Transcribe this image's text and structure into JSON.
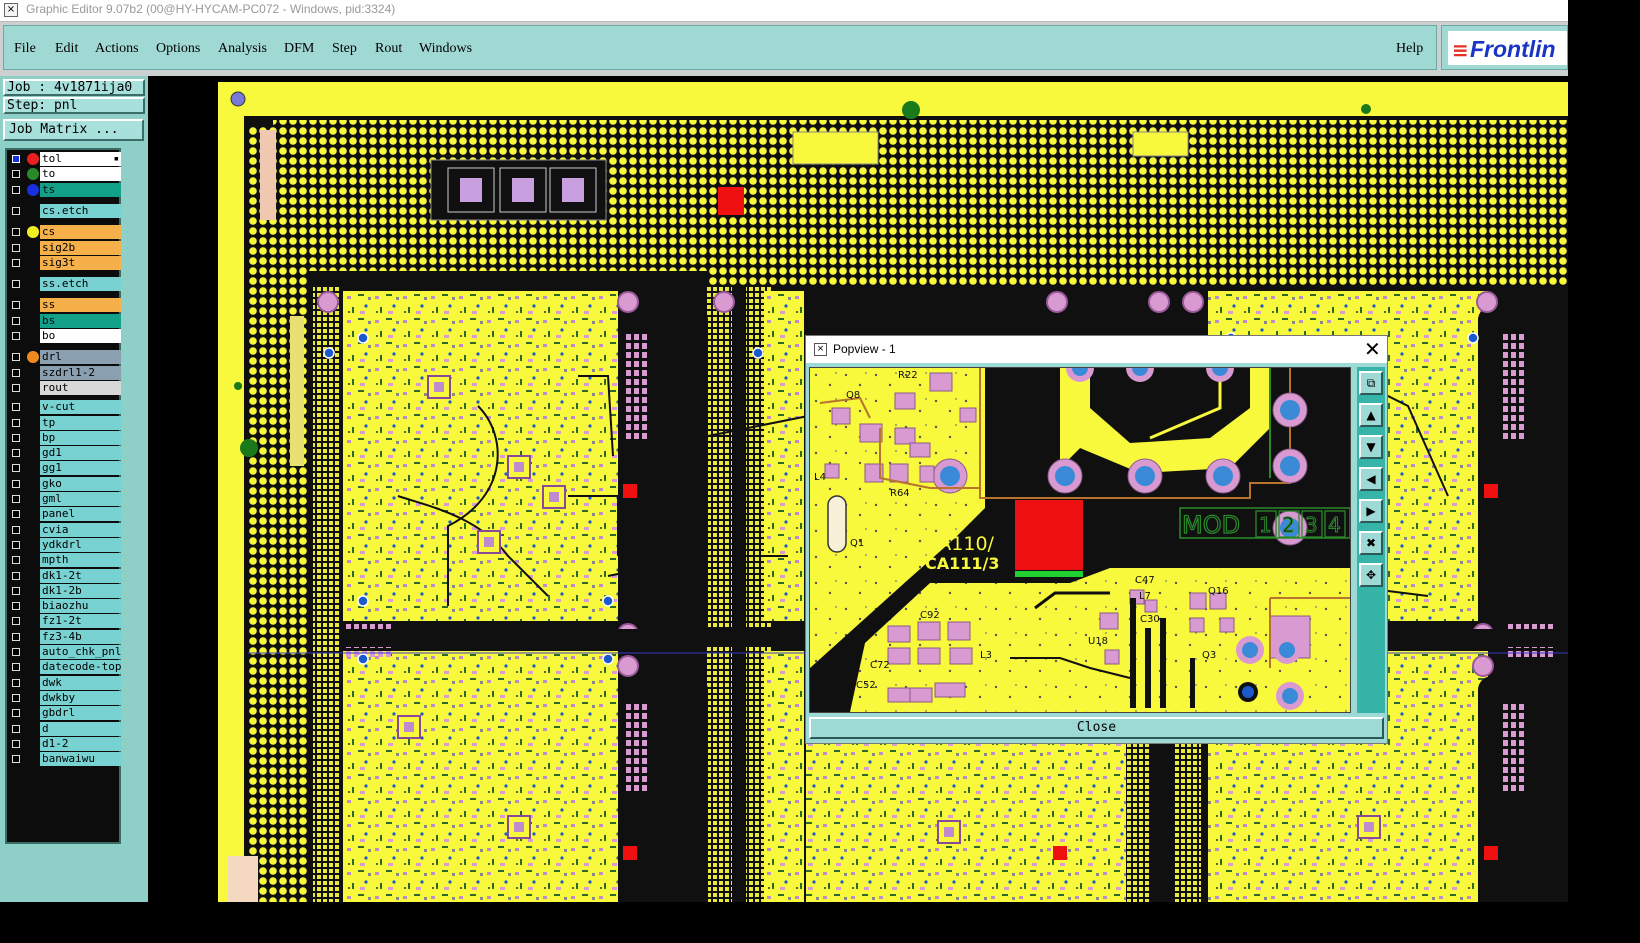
{
  "window": {
    "title": "Graphic Editor 9.07b2 (00@HY-HYCAM-PC072 - Windows, pid:3324)"
  },
  "menu": {
    "file": "File",
    "edit": "Edit",
    "actions": "Actions",
    "options": "Options",
    "analysis": "Analysis",
    "dfm": "DFM",
    "step": "Step",
    "rout": "Rout",
    "windows": "Windows",
    "help": "Help"
  },
  "logo": {
    "text": "Frontlin"
  },
  "job": {
    "job_line": "Job : 4v1871ija0",
    "step_line": "Step: pnl",
    "matrix_button": "Job Matrix ..."
  },
  "layers": [
    {
      "name": "tol",
      "color": "white",
      "dot": "#e82020",
      "active": true
    },
    {
      "name": "to",
      "color": "white",
      "dot": "#2a8a2a"
    },
    {
      "name": "ts",
      "color": "teal",
      "dot": "#1830e0"
    },
    {
      "name": "cs.etch",
      "color": "cyan"
    },
    {
      "name": "cs",
      "color": "orange",
      "dot": "#f0f020"
    },
    {
      "name": "sig2b",
      "color": "orange"
    },
    {
      "name": "sig3t",
      "color": "orange"
    },
    {
      "name": "ss.etch",
      "color": "cyan"
    },
    {
      "name": "ss",
      "color": "orange"
    },
    {
      "name": "bs",
      "color": "teal"
    },
    {
      "name": "bo",
      "color": "white"
    },
    {
      "name": "drl",
      "color": "slate",
      "dot": "#f08a20"
    },
    {
      "name": "szdrl1-2",
      "color": "slate"
    },
    {
      "name": "rout",
      "color": "lgray"
    },
    {
      "name": "v-cut",
      "color": "cyan"
    },
    {
      "name": "tp",
      "color": "cyan"
    },
    {
      "name": "bp",
      "color": "cyan"
    },
    {
      "name": "gd1",
      "color": "cyan"
    },
    {
      "name": "gg1",
      "color": "cyan"
    },
    {
      "name": "gko",
      "color": "cyan"
    },
    {
      "name": "gml",
      "color": "cyan"
    },
    {
      "name": "panel",
      "color": "cyan"
    },
    {
      "name": "cvia",
      "color": "cyan"
    },
    {
      "name": "ydkdrl",
      "color": "cyan"
    },
    {
      "name": "mpth",
      "color": "cyan"
    },
    {
      "name": "dk1-2t",
      "color": "cyan"
    },
    {
      "name": "dk1-2b",
      "color": "cyan"
    },
    {
      "name": "biaozhu",
      "color": "cyan"
    },
    {
      "name": "fz1-2t",
      "color": "cyan"
    },
    {
      "name": "fz3-4b",
      "color": "cyan"
    },
    {
      "name": "auto_chk_pnl",
      "color": "cyan"
    },
    {
      "name": "datecode-top",
      "color": "cyan"
    },
    {
      "name": "dwk",
      "color": "cyan"
    },
    {
      "name": "dwkby",
      "color": "cyan"
    },
    {
      "name": "gbdrl",
      "color": "cyan"
    },
    {
      "name": "d",
      "color": "cyan"
    },
    {
      "name": "d1-2",
      "color": "cyan"
    },
    {
      "name": "banwaiwu",
      "color": "cyan"
    }
  ],
  "popup": {
    "title": "Popview - 1",
    "close_label": "Close",
    "marking_1": "CA110/",
    "marking_2": "CA111/3",
    "mod_label": "MOD",
    "mod_numbers": [
      "1",
      "2",
      "3",
      "4"
    ],
    "refdes": {
      "q8": "Q8",
      "r22": "R22",
      "r64": "R64",
      "q1": "Q1",
      "c47": "C47",
      "l7": "L7",
      "c30": "C30",
      "u18": "U18",
      "q16": "Q16",
      "q3": "Q3",
      "l3": "L3",
      "c92": "C92",
      "c72": "C72",
      "c52": "C52",
      "l4": "L4"
    }
  },
  "colors": {
    "board": "#f8f83c",
    "copper": "#101010",
    "pad": "#d89ad0",
    "ui_teal": "#a0d8d4",
    "marker_red": "#ee1010"
  }
}
